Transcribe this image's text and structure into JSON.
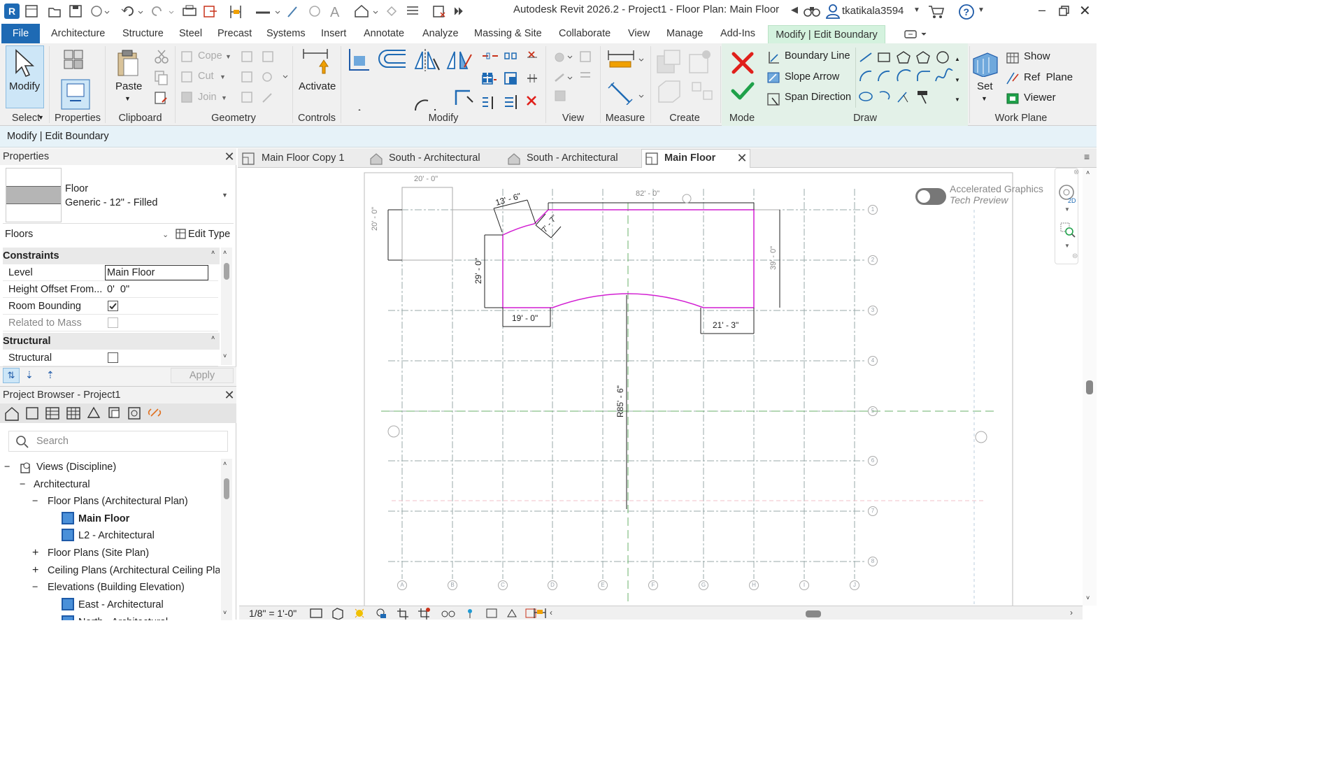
{
  "app": {
    "title": "Autodesk Revit 2026.2 - Project1 - Floor Plan: Main Floor",
    "username": "tkatikala3594",
    "logo_letter": "R"
  },
  "ribbon_tabs": [
    "File",
    "Architecture",
    "Structure",
    "Steel",
    "Precast",
    "Systems",
    "Insert",
    "Annotate",
    "Analyze",
    "Massing & Site",
    "Collaborate",
    "View",
    "Manage",
    "Add-Ins",
    "Modify | Edit Boundary"
  ],
  "ribbon": {
    "modify_label": "Modify",
    "paste_label": "Paste",
    "activate_label": "Activate",
    "cope_label": "Cope",
    "cut_label": "Cut",
    "join_label": "Join",
    "boundary_line_label": "Boundary Line",
    "slope_arrow_label": "Slope Arrow",
    "span_direction_label": "Span Direction",
    "set_label": "Set",
    "show_label": "Show",
    "ref_plane_label": "Ref  Plane",
    "viewer_label": "Viewer",
    "panels": {
      "select": "Select",
      "properties": "Properties",
      "clipboard": "Clipboard",
      "geometry": "Geometry",
      "controls": "Controls",
      "modify": "Modify",
      "view": "View",
      "measure": "Measure",
      "create": "Create",
      "mode": "Mode",
      "draw": "Draw",
      "work_plane": "Work Plane"
    }
  },
  "context_bar": "Modify | Edit Boundary",
  "properties": {
    "header": "Properties",
    "type_name": "Floor",
    "type_value": "Generic - 12\" - Filled",
    "category": "Floors",
    "edit_type": "Edit Type",
    "sections": {
      "constraints": "Constraints",
      "structural": "Structural"
    },
    "rows": {
      "level_label": "Level",
      "level_value": "Main Floor",
      "height_offset_label": "Height Offset From...",
      "height_offset_value": "0'  0\"",
      "room_bounding_label": "Room Bounding",
      "room_bounding_checked": true,
      "related_mass_label": "Related to Mass",
      "related_mass_checked": false,
      "structural_label": "Structural",
      "structural_checked": false
    },
    "apply": "Apply"
  },
  "project_browser": {
    "header": "Project Browser - Project1",
    "search_placeholder": "Search",
    "tree": [
      "Views (Discipline)",
      "Architectural",
      "Floor Plans (Architectural Plan)",
      "Main Floor",
      "L2 - Architectural",
      "Floor Plans (Site Plan)",
      "Ceiling Plans (Architectural Ceiling Pla",
      "Elevations (Building Elevation)",
      "East - Architectural",
      "North - Architectural"
    ]
  },
  "view_tabs": [
    "Main Floor Copy 1",
    "South - Architectural",
    "South - Architectural",
    "Main Floor"
  ],
  "canvas": {
    "accelerated_graphics": "Accelerated Graphics",
    "tech_preview": "Tech Preview",
    "grid_rows": [
      "1",
      "2",
      "3",
      "4",
      "5",
      "6",
      "7",
      "8"
    ],
    "grid_cols": [
      "A",
      "B",
      "C",
      "D",
      "E",
      "F",
      "G",
      "H",
      "I",
      "J"
    ],
    "dims": {
      "d20_top": "20' - 0\"",
      "d20_left": "20' - 0\"",
      "d13_6": "13' - 6\"",
      "d7": "7' - 7\"",
      "d82": "82' - 0\"",
      "d39": "39' - 0\"",
      "d29": "29' - 0\"",
      "d19": "19' - 0\"",
      "d21_3": "21' - 3\"",
      "radius": "R85' - 6\""
    }
  },
  "view_control_bar": {
    "scale": "1/8\" = 1'-0\""
  },
  "colors": {
    "file_tab": "#1e6ab4",
    "modify_tab": "#d4f2de",
    "sketch_line": "#d21ed2",
    "mode_finish": "#1fa14a",
    "mode_cancel": "#e0201b"
  }
}
